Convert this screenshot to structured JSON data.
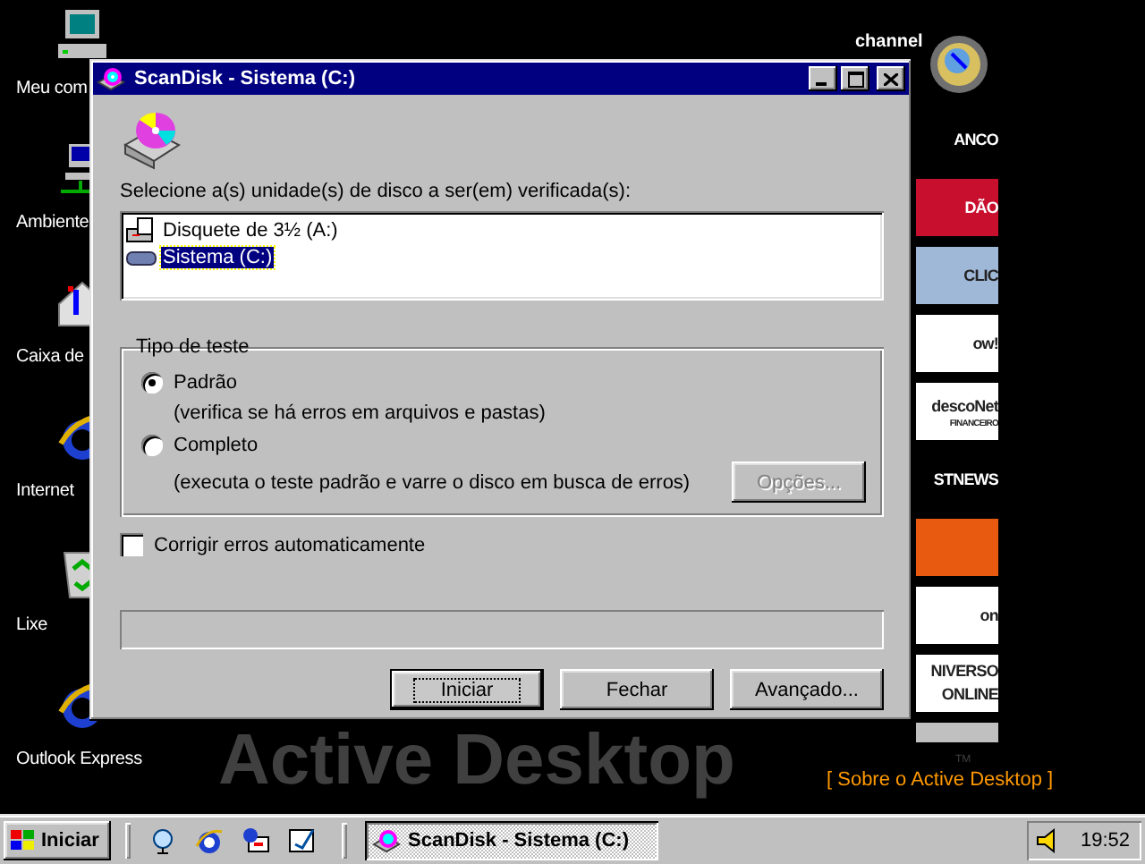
{
  "desktop_icons": [
    {
      "label": "Meu com",
      "kind": "computer"
    },
    {
      "label": "Ambiente",
      "kind": "network"
    },
    {
      "label": "Caixa de",
      "kind": "inbox"
    },
    {
      "label": "Internet",
      "kind": "browser"
    },
    {
      "label": "Lixe",
      "kind": "recycle"
    },
    {
      "label": "Outlook Express",
      "kind": "browser"
    }
  ],
  "channel_bar": {
    "title": "channel",
    "channels": [
      {
        "lines": [
          "ANCO"
        ],
        "color": "#000000"
      },
      {
        "lines": [
          "DÃO"
        ],
        "color": "#c8102e"
      },
      {
        "lines": [
          "CLIC"
        ],
        "color": "#9fb8d8"
      },
      {
        "lines": [
          "ow!"
        ],
        "color": "#ffffff"
      },
      {
        "lines": [
          "descoNet",
          "FINANCEIRO"
        ],
        "color": "#ffffff"
      },
      {
        "lines": [
          "STNEWS"
        ],
        "color": "#000000"
      },
      {
        "color": "#e85a10"
      },
      {
        "lines": [
          "on"
        ],
        "color": "#ffffff"
      },
      {
        "lines": [
          "NIVERSO",
          "ONLINE"
        ],
        "color": "#ffffff"
      }
    ]
  },
  "wallpaper": {
    "title": "Active Desktop",
    "mark": "TM",
    "link": "[ Sobre o Active Desktop ]"
  },
  "dialog": {
    "title": "ScanDisk - Sistema (C:)",
    "prompt": "Selecione a(s) unidade(s) de disco a ser(em) verificada(s):",
    "drives": [
      {
        "label": "Disquete de 3½ (A:)",
        "kind": "floppy",
        "selected": false
      },
      {
        "label": "Sistema (C:)",
        "kind": "hdd",
        "selected": true
      }
    ],
    "test_type": {
      "legend": "Tipo de teste",
      "options": [
        {
          "label": "Padrão",
          "description": "(verifica se há erros em arquivos e pastas)",
          "selected": true
        },
        {
          "label": "Completo",
          "description": "(executa o teste padrão e varre o disco em busca de erros)",
          "selected": false
        }
      ],
      "options_button": {
        "label": "Opções...",
        "disabled": true
      }
    },
    "auto_fix": {
      "label": "Corrigir erros automaticamente",
      "checked": false
    },
    "progress": {
      "level": 0
    },
    "buttons": [
      {
        "label": "Iniciar",
        "focused": true
      },
      {
        "label": "Fechar",
        "focused": false
      },
      {
        "label": "Avançado...",
        "focused": false
      }
    ]
  },
  "taskbar": {
    "start": "Iniciar",
    "tasks": [
      {
        "label": "ScanDisk - Sistema (C:)",
        "selected": true
      }
    ],
    "clock": "19:52"
  }
}
